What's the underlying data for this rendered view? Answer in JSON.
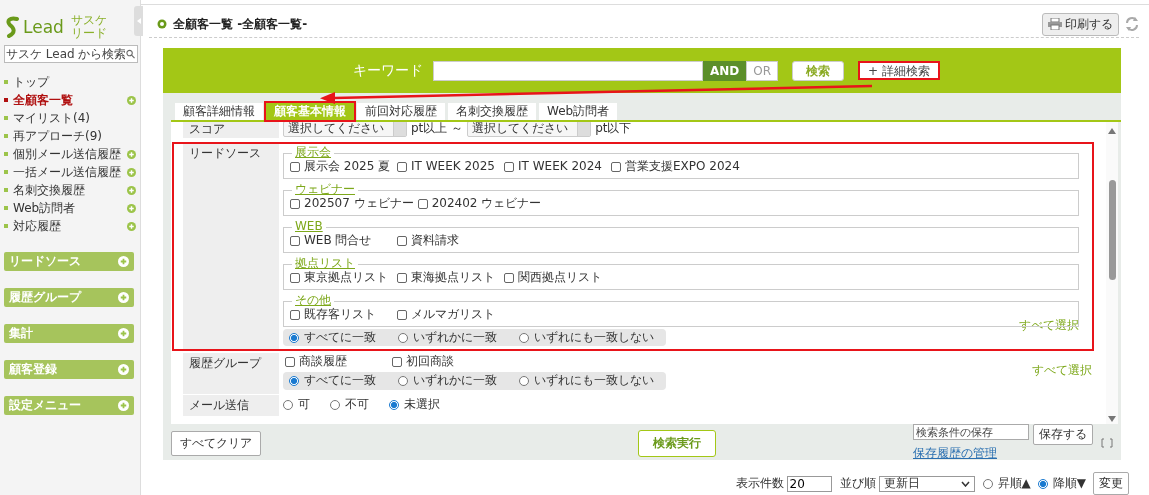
{
  "sidebar": {
    "logo": "Lead",
    "logo_sub": [
      "サスケ",
      "リード"
    ],
    "search": {
      "placeholder": "サスケ Lead から検索"
    },
    "items": [
      {
        "label": "トップ",
        "selected": false,
        "has_add": false
      },
      {
        "label": "全顧客一覧",
        "selected": true,
        "has_add": true
      },
      {
        "label": "マイリスト(4)",
        "selected": false,
        "has_add": false
      },
      {
        "label": "再アプローチ(9)",
        "selected": false,
        "has_add": false
      },
      {
        "label": "個別メール送信履歴",
        "selected": false,
        "has_add": true
      },
      {
        "label": "一括メール送信履歴",
        "selected": false,
        "has_add": true
      },
      {
        "label": "名刺交換履歴",
        "selected": false,
        "has_add": true
      },
      {
        "label": "Web訪問者",
        "selected": false,
        "has_add": true
      },
      {
        "label": "対応履歴",
        "selected": false,
        "has_add": true
      }
    ],
    "sections": [
      "リードソース",
      "履歴グループ",
      "集計",
      "顧客登録",
      "設定メニュー"
    ]
  },
  "page_title": "全顧客一覧 -全顧客一覧-",
  "print_button": "印刷する",
  "keyword": {
    "label": "キーワード",
    "modes": [
      {
        "label": "AND",
        "selected": true
      },
      {
        "label": "OR",
        "selected": false
      }
    ],
    "search_button": "検索",
    "detail_button": "+ 詳細検索",
    "detail_highlighted": true
  },
  "annotation_arrow": true,
  "tabs": [
    {
      "label": "顧客詳細情報",
      "selected": false,
      "highlighted": false
    },
    {
      "label": "顧客基本情報",
      "selected": true,
      "highlighted": true
    },
    {
      "label": "前回対応履歴",
      "selected": false,
      "highlighted": false
    },
    {
      "label": "名刺交換履歴",
      "selected": false,
      "highlighted": false
    },
    {
      "label": "Web訪問者",
      "selected": false,
      "highlighted": false
    }
  ],
  "score": {
    "label": "スコア",
    "from": "選択してください",
    "from_suffix": "pt以上 ～",
    "to": "選択してください",
    "to_suffix": "pt以下"
  },
  "lead_source": {
    "label": "リードソース",
    "highlighted": true,
    "select_all": "すべて選択",
    "groups": [
      {
        "title": "展示会",
        "options": [
          {
            "label": "展示会 2025 夏",
            "checked": false
          },
          {
            "label": "IT WEEK 2025",
            "checked": false
          },
          {
            "label": "IT WEEK 2024",
            "checked": false
          },
          {
            "label": "営業支援EXPO 2024",
            "checked": false
          }
        ]
      },
      {
        "title": "ウェビナー",
        "options": [
          {
            "label": "202507 ウェビナー",
            "checked": false
          },
          {
            "label": "202402 ウェビナー",
            "checked": false
          }
        ]
      },
      {
        "title": "WEB",
        "options": [
          {
            "label": "WEB 問合せ",
            "checked": false
          },
          {
            "label": "資料請求",
            "checked": false
          }
        ]
      },
      {
        "title": "拠点リスト",
        "options": [
          {
            "label": "東京拠点リスト",
            "checked": false
          },
          {
            "label": "東海拠点リスト",
            "checked": false
          },
          {
            "label": "関西拠点リスト",
            "checked": false
          }
        ]
      },
      {
        "title": "その他",
        "options": [
          {
            "label": "既存客リスト",
            "checked": false
          },
          {
            "label": "メルマガリスト",
            "checked": false
          }
        ]
      }
    ],
    "match": [
      {
        "label": "すべてに一致",
        "selected": true
      },
      {
        "label": "いずれかに一致",
        "selected": false
      },
      {
        "label": "いずれにも一致しない",
        "selected": false
      }
    ]
  },
  "history_group": {
    "label": "履歴グループ",
    "select_all": "すべて選択",
    "options": [
      {
        "label": "商談履歴",
        "checked": false
      },
      {
        "label": "初回商談",
        "checked": false
      }
    ],
    "match": [
      {
        "label": "すべてに一致",
        "selected": true
      },
      {
        "label": "いずれかに一致",
        "selected": false
      },
      {
        "label": "いずれにも一致しない",
        "selected": false
      }
    ]
  },
  "mail": {
    "label": "メール送信",
    "options": [
      {
        "label": "可",
        "selected": false
      },
      {
        "label": "不可",
        "selected": false
      },
      {
        "label": "未選択",
        "selected": true
      }
    ]
  },
  "bottom": {
    "clear_button": "すべてクリア",
    "run_button": "検索実行",
    "save_placeholder": "検索条件の保存",
    "save_button": "保存する",
    "history_link": "保存履歴の管理"
  },
  "footer": {
    "count_label": "表示件数",
    "count": "20",
    "sort_label": "並び順",
    "sort": "更新日",
    "orders": [
      {
        "label": "昇順▲",
        "selected": false
      },
      {
        "label": "降順▼",
        "selected": true
      }
    ],
    "change_button": "変更"
  }
}
